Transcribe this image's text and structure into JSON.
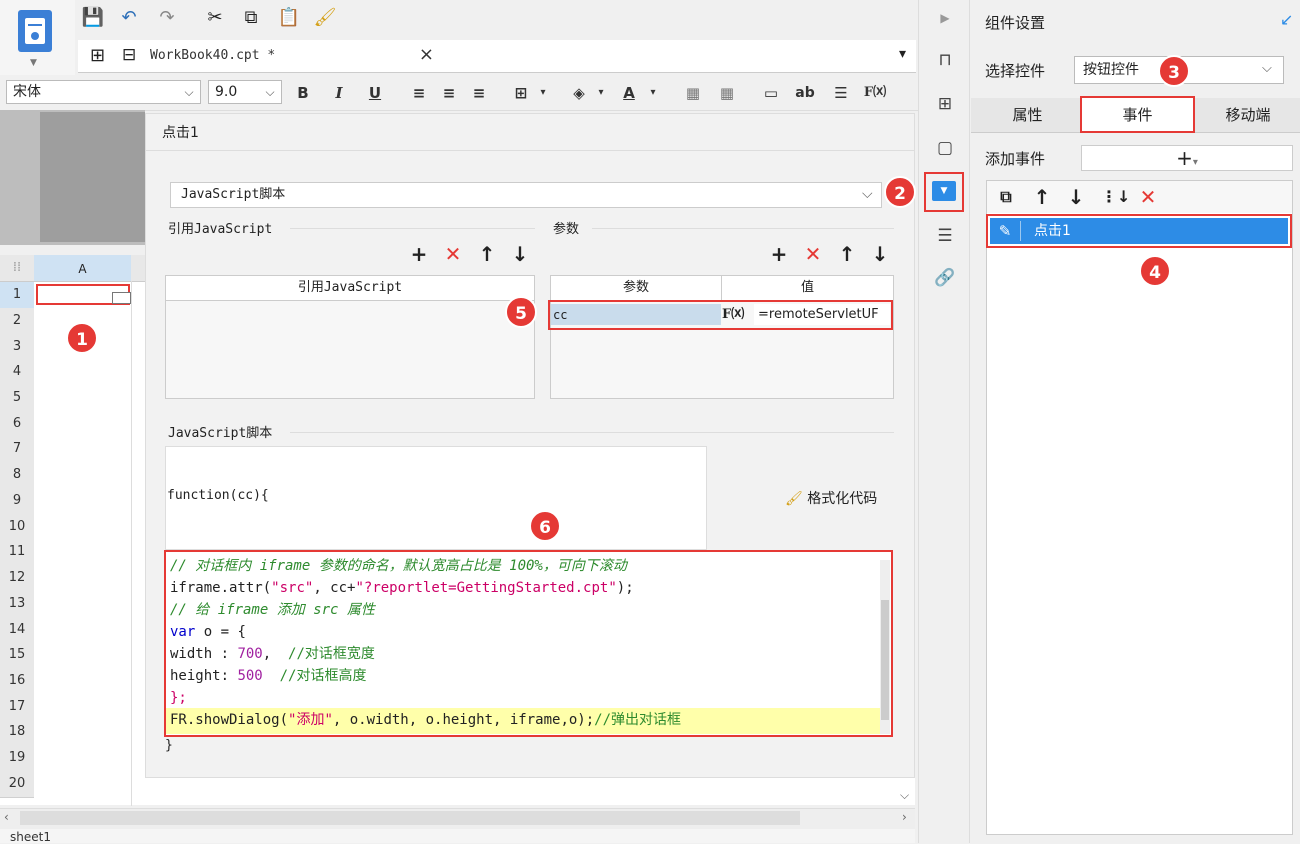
{
  "tab": {
    "title": "WorkBook40.cpt *"
  },
  "format": {
    "font": "宋体",
    "size": "9.0"
  },
  "grid": {
    "column": "A",
    "rows": [
      "1",
      "2",
      "3",
      "4",
      "5",
      "6",
      "7",
      "8",
      "9",
      "10",
      "11",
      "12",
      "13",
      "14",
      "15",
      "16",
      "17",
      "18",
      "19",
      "20"
    ]
  },
  "event": {
    "title": "点击1",
    "script_type": "JavaScript脚本",
    "ref_section": "引用JavaScript",
    "ref_column": "引用JavaScript",
    "param_section": "参数",
    "param_col_name": "参数",
    "param_col_value": "值",
    "param_name": "cc",
    "param_value": "=remoteServletUF",
    "script_section": "JavaScript脚本",
    "func_head": "function(cc){",
    "format_code": "格式化代码",
    "func_close": "}",
    "code": {
      "l1": "// 对话框内 iframe 参数的命名，默认宽高占比是 100%，可向下滚动",
      "l2a": "iframe.attr(",
      "l2b": "\"src\"",
      "l2c": ", cc+",
      "l2d": "\"?reportlet=GettingStarted.cpt\"",
      "l2e": ");",
      "l3": "// 给 iframe 添加 src 属性",
      "l4a": "var",
      "l4b": " o = {",
      "l5a": "width : ",
      "l5b": "700",
      "l5c": ",  ",
      "l5d": "//对话框宽度",
      "l6a": "height: ",
      "l6b": "500",
      "l6c": "  ",
      "l6d": "//对话框高度",
      "l7": "};",
      "l8a": "FR.showDialog(",
      "l8b": "\"添加\"",
      "l8c": ", o.width, o.height, iframe,o);",
      "l8d": "//弹出对话框"
    }
  },
  "right_panel": {
    "title": "组件设置",
    "select_label": "选择控件",
    "select_value": "按钮控件",
    "tabs": [
      "属性",
      "事件",
      "移动端"
    ],
    "add_event_label": "添加事件",
    "event_item": "点击1"
  },
  "sheet": {
    "name": "sheet1"
  },
  "badges": [
    "1",
    "2",
    "3",
    "4",
    "5",
    "6"
  ]
}
